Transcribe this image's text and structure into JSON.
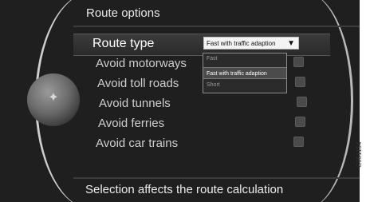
{
  "header": {
    "title": "Route options"
  },
  "rows": [
    {
      "label": "Route type"
    },
    {
      "label": "Avoid motorways"
    },
    {
      "label": "Avoid toll roads"
    },
    {
      "label": "Avoid tunnels"
    },
    {
      "label": "Avoid ferries"
    },
    {
      "label": "Avoid car trains"
    }
  ],
  "route_type": {
    "selected": "Fast with traffic adaption",
    "arrow": "▼",
    "options": [
      "Fast",
      "Fast with traffic adaption",
      "Short"
    ]
  },
  "status": {
    "text": "Selection affects the route calculation"
  },
  "image_code": "G051154",
  "icons": {
    "knob": "navigation-knob-icon",
    "dropdown": "chevron-down-icon"
  }
}
